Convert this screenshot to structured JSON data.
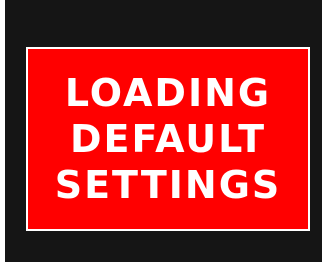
{
  "message": {
    "lines": [
      "LOADING",
      "DEFAULT",
      "SETTINGS"
    ]
  },
  "colors": {
    "background": "#151515",
    "panel": "#ff0000",
    "border": "#ffffff",
    "text": "#ffffff"
  }
}
